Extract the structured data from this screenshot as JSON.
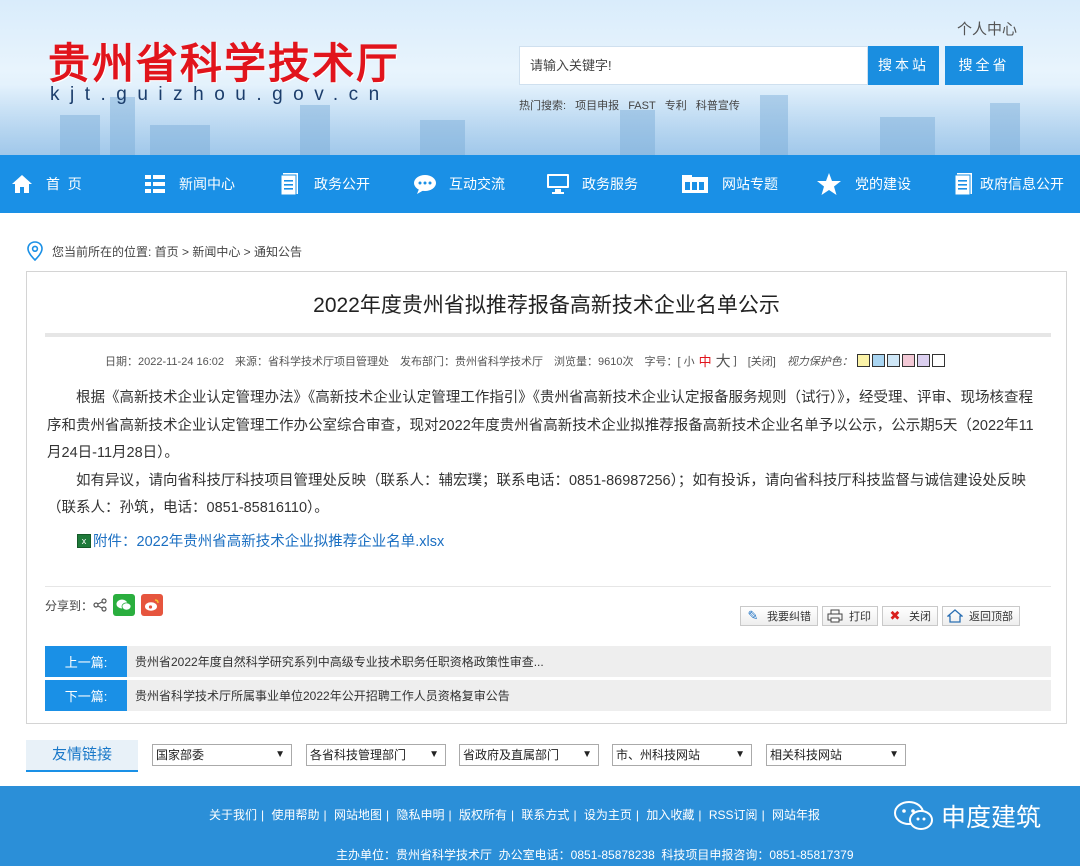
{
  "header": {
    "site_title": "贵州省科学技术厅",
    "domain": "kjt.guizhou.gov.cn",
    "user_center": "个人中心",
    "search_placeholder": "请输入关键字!",
    "search_site": "搜本站",
    "search_province": "搜全省",
    "hot_label": "热门搜索:",
    "hot_terms": [
      "项目申报",
      "FAST",
      "专利",
      "科普宣传"
    ]
  },
  "nav": {
    "items": [
      {
        "label": "首  页",
        "icon": "home-icon"
      },
      {
        "label": "新闻中心",
        "icon": "list-icon"
      },
      {
        "label": "政务公开",
        "icon": "document-icon"
      },
      {
        "label": "互动交流",
        "icon": "chat-icon"
      },
      {
        "label": "政务服务",
        "icon": "monitor-icon"
      },
      {
        "label": "网站专题",
        "icon": "folder-icon"
      },
      {
        "label": "党的建设",
        "icon": "star-icon"
      },
      {
        "label": "政府信息公开",
        "icon": "document-icon"
      }
    ]
  },
  "breadcrumb": {
    "text": "您当前所在的位置: 首页 > 新闻中心 > 通知公告"
  },
  "article": {
    "title": "2022年度贵州省拟推荐报备高新技术企业名单公示",
    "meta": {
      "date": "日期：2022-11-24 16:02",
      "source": "来源：省科学技术厅项目管理处",
      "dept": "发布部门：贵州省科学技术厅",
      "views": "浏览量：9610次",
      "font_label": "字号：[",
      "font_small": "小",
      "font_mid": "中",
      "font_big": "大",
      "font_end": "]",
      "close": "[关闭]",
      "eye_label": "视力保护色：",
      "swatches": [
        "#fbf3a8",
        "#a9d5f2",
        "#cfe7f7",
        "#f3c9d6",
        "#dcd0f0",
        "#ffffff"
      ]
    },
    "para1": "根据《高新技术企业认定管理办法》《高新技术企业认定管理工作指引》《贵州省高新技术企业认定报备服务规则（试行）》，经受理、评审、现场核查程序和贵州省高新技术企业认定管理工作办公室综合审查，现对2022年度贵州省高新技术企业拟推荐报备高新技术企业名单予以公示，公示期5天（2022年11月24日-11月28日）。",
    "para2": "如有异议，请向省科技厅科技项目管理处反映（联系人：辅宏璞；联系电话：0851-86987256）；如有投诉，请向省科技厅科技监督与诚信建设处反映（联系人：孙筑，电话：0851-85816110）。",
    "attachment": "附件：2022年贵州省高新技术企业拟推荐企业名单.xlsx",
    "share_label": "分享到：",
    "tools": [
      "我要纠错",
      "打印",
      "关闭",
      "返回顶部"
    ],
    "prev_label": "上一篇:",
    "prev_title": "贵州省2022年度自然科学研究系列中高级专业技术职务任职资格政策性审查...",
    "next_label": "下一篇:",
    "next_title": "贵州省科学技术厅所属事业单位2022年公开招聘工作人员资格复审公告"
  },
  "links": {
    "label": "友情链接",
    "selects": [
      "国家部委",
      "各省科技管理部门",
      "省政府及直属部门",
      "市、州科技网站",
      "相关科技网站"
    ]
  },
  "footer": {
    "links": [
      "关于我们",
      "使用帮助",
      "网站地图",
      "隐私申明",
      "版权所有",
      "联系方式",
      "设为主页",
      "加入收藏",
      "RSS订阅",
      "网站年报"
    ],
    "sponsor": "主办单位：贵州省科学技术厅  办公室电话：0851-85878238  科技项目申报咨询：0851-85817379",
    "watermark": "申度建筑"
  },
  "colors": {
    "nav": "#1a90e6",
    "title_red": "#e1141c",
    "footer": "#2b8fd8",
    "link": "#1b6fc2"
  }
}
